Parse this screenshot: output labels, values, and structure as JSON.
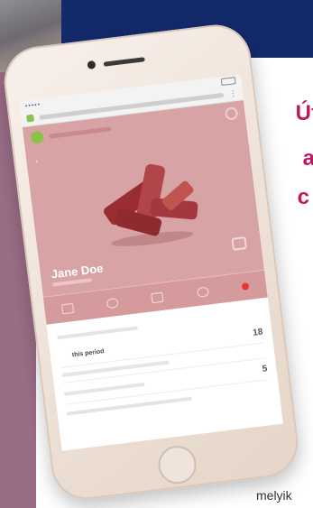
{
  "background": {
    "navy": "#132a6b",
    "mauve": "#9a6d87",
    "accent_text_color": "#c2185b",
    "side_text": [
      "Úf",
      "a",
      "c"
    ],
    "footer_word": "melyik"
  },
  "phone": {
    "status_bar": {
      "signal": "•••••",
      "time": "",
      "battery": ""
    },
    "profile": {
      "name": "Jane Doe"
    },
    "tabs": [
      {
        "icon": "home-icon"
      },
      {
        "icon": "chat-icon"
      },
      {
        "icon": "message-icon"
      },
      {
        "icon": "phone-icon"
      },
      {
        "icon": "notification-dot-icon"
      }
    ],
    "rows": [
      {
        "label": "this period",
        "value": "18"
      },
      {
        "label": "",
        "value": "5"
      }
    ],
    "colors": {
      "hero": "#d8a3a4",
      "notification": "#e53935"
    }
  }
}
